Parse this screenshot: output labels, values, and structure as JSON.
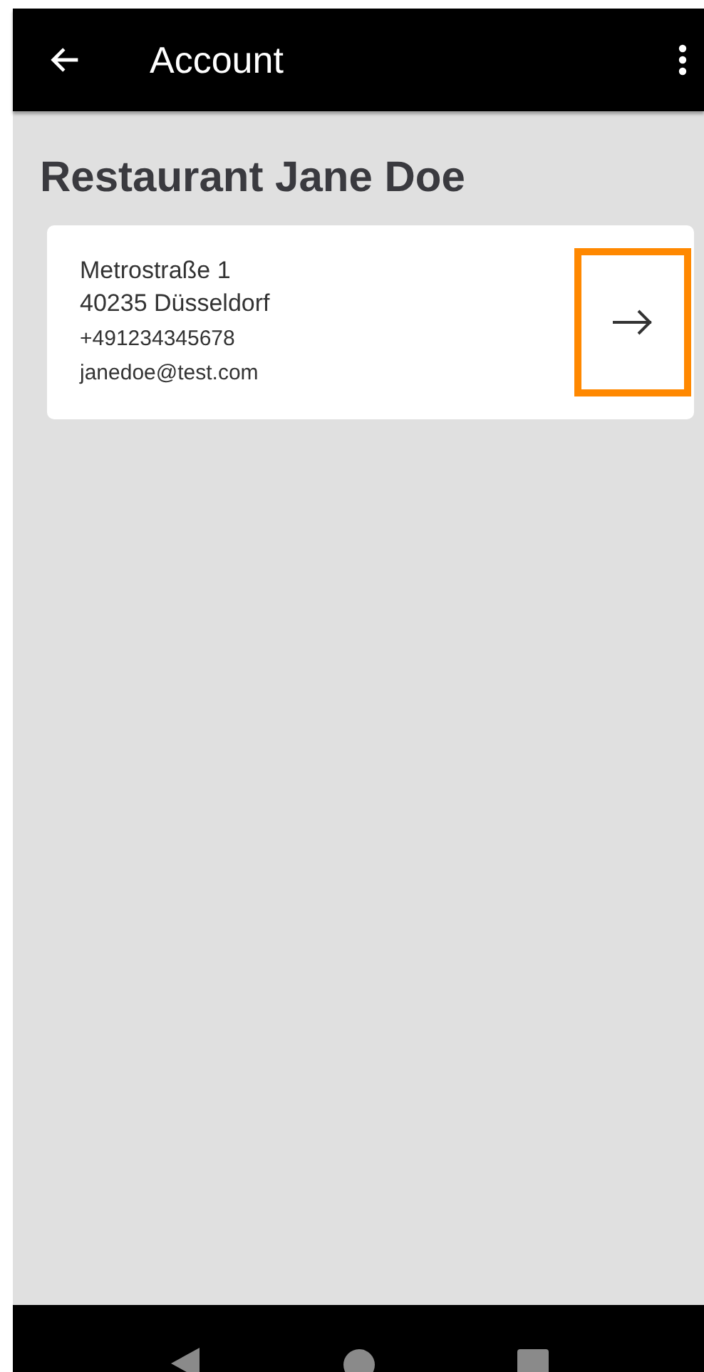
{
  "app_bar": {
    "title": "Account"
  },
  "heading": "Restaurant Jane Doe",
  "card": {
    "street": "Metrostraße 1",
    "city": "40235 Düsseldorf",
    "phone": "+491234345678",
    "email": "janedoe@test.com",
    "open_button": {
      "highlighted": true
    }
  }
}
